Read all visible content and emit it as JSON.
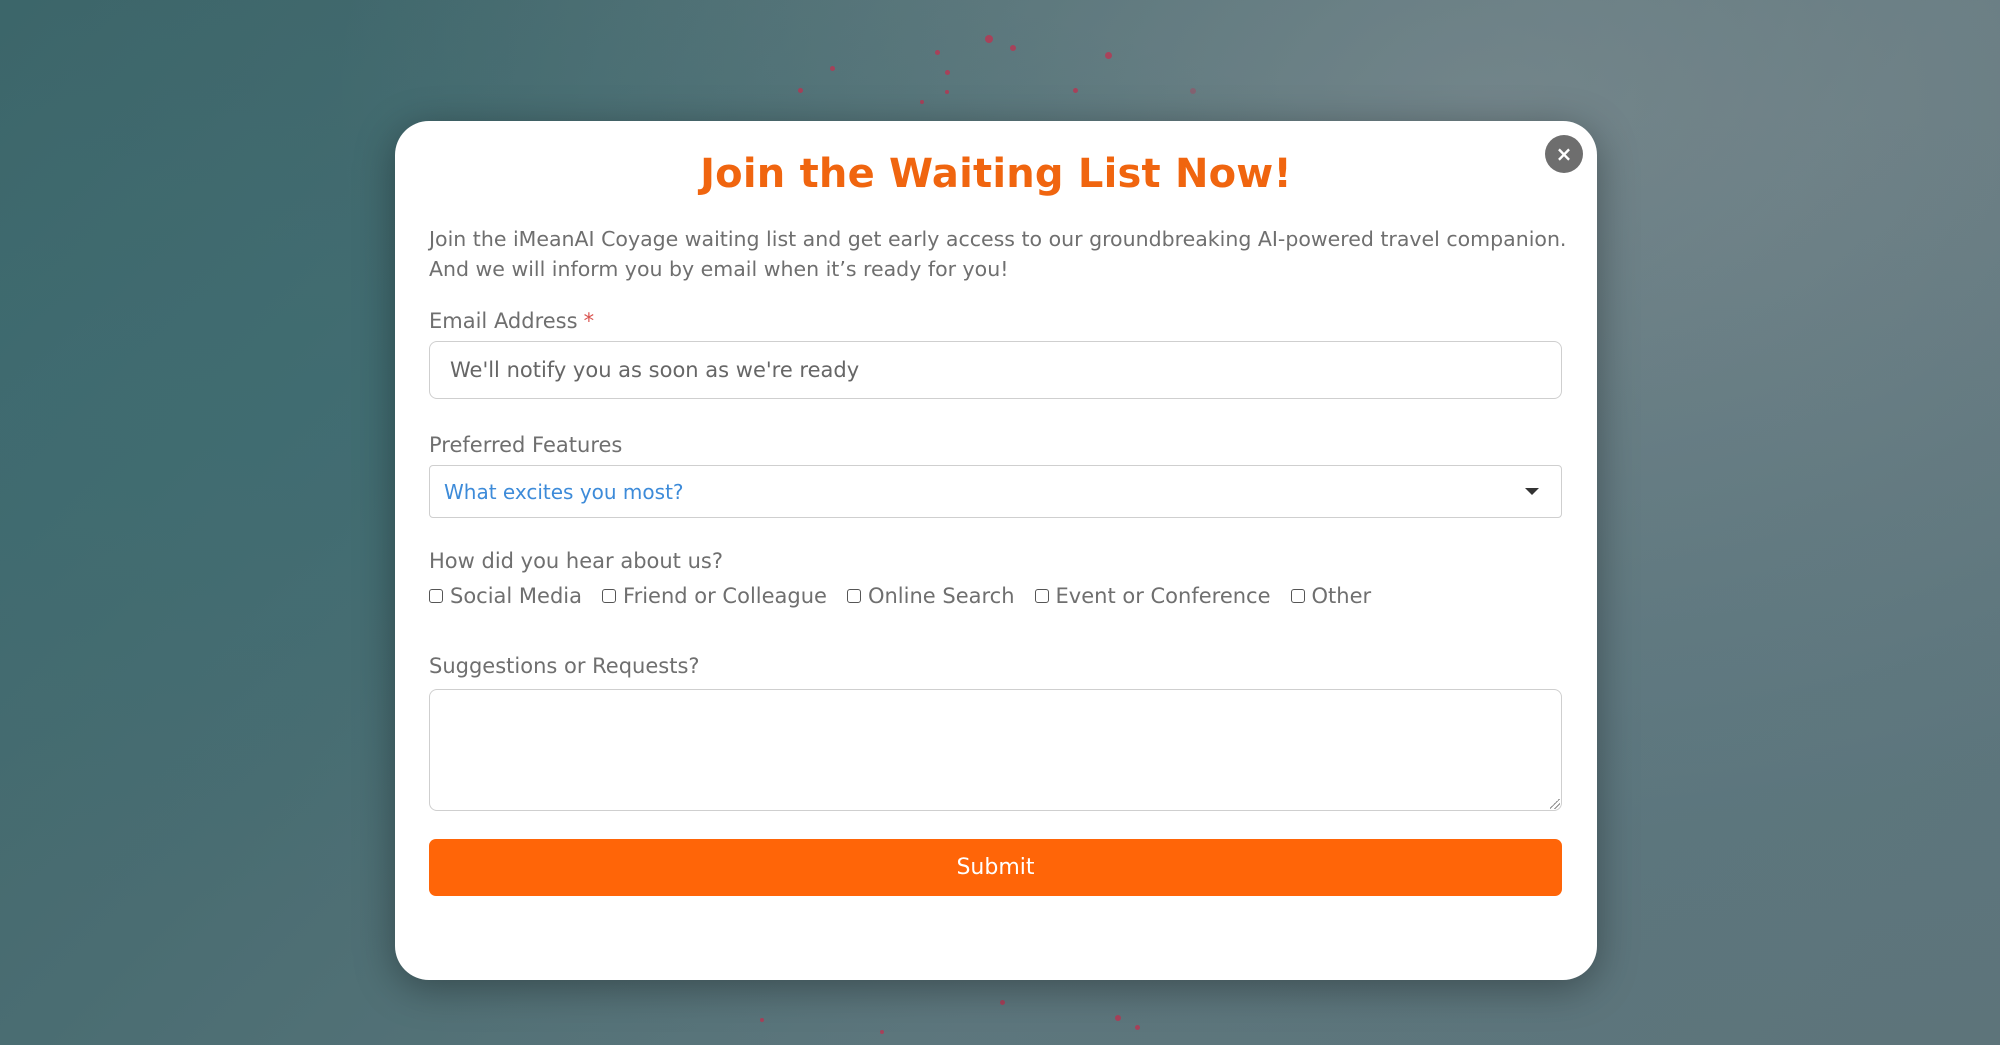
{
  "modal": {
    "title": "Join the Waiting List Now!",
    "intro_line1": "Join the iMeanAI Coyage waiting list and get early access to our groundbreaking AI-powered travel companion.",
    "intro_line2": "And we will inform you by email when it’s ready for you!",
    "close_glyph": "×"
  },
  "email": {
    "label": "Email Address",
    "required_mark": "*",
    "placeholder": "We'll notify you as soon as we're ready",
    "value": ""
  },
  "features": {
    "label": "Preferred Features",
    "selected": "What excites you most?"
  },
  "source": {
    "label": "How did you hear about us?",
    "options": [
      {
        "label": "Social Media",
        "checked": false
      },
      {
        "label": "Friend or Colleague",
        "checked": false
      },
      {
        "label": "Online Search",
        "checked": false
      },
      {
        "label": "Event or Conference",
        "checked": false
      },
      {
        "label": "Other",
        "checked": false
      }
    ]
  },
  "suggestions": {
    "label": "Suggestions or Requests?",
    "value": ""
  },
  "submit_label": "Submit",
  "colors": {
    "accent": "#ff6508",
    "title": "#f0650f",
    "select_text": "#3d8bd9",
    "required": "#d9534f"
  }
}
